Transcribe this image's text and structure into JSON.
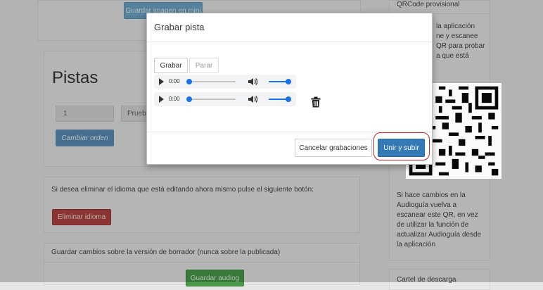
{
  "background": {
    "top_button_label": "Guardar imagen en mini",
    "tracks_title": "Pistas",
    "order_input_value": "1",
    "track_select_value": "Prueba",
    "change_order_label": "Cambiar orden",
    "delete_lang_text": "Si desea eliminar el idioma que está editando ahora mismo pulse el siguiente botón:",
    "delete_lang_button": "Eliminar idioma",
    "draft_text": "Guardar cambios sobre la versión de borrador (nunca sobre la publicada)",
    "save_audio_button": "Guardar audiog",
    "sidebar_qr_title": "QRCode provisional",
    "sidebar_qr_lines": [
      "la aplicación",
      "ne y escanee",
      "QR para probar",
      "a que está"
    ],
    "sidebar_help_lines": [
      "Si hace cambios en la",
      "Audioguía vuelva a",
      "escanear este QR, en vez",
      "de utilizar la función de",
      "actualizar Audioguía desde",
      "la aplicación"
    ],
    "sidebar_download_title": "Cartel de descarga"
  },
  "modal": {
    "title": "Grabar pista",
    "record_label": "Grabar",
    "stop_label": "Parar",
    "players": [
      {
        "time": "0:00",
        "volume": 1.0
      },
      {
        "time": "0:00",
        "volume": 1.0
      }
    ],
    "cancel_label": "Cancelar grabaciones",
    "upload_label": "Unir y subir"
  },
  "colors": {
    "primary": "#337ab7",
    "danger": "#d9534f",
    "success": "#5cb85c",
    "highlight_ring": "#c0282d",
    "audio_accent": "#1a73e8"
  }
}
